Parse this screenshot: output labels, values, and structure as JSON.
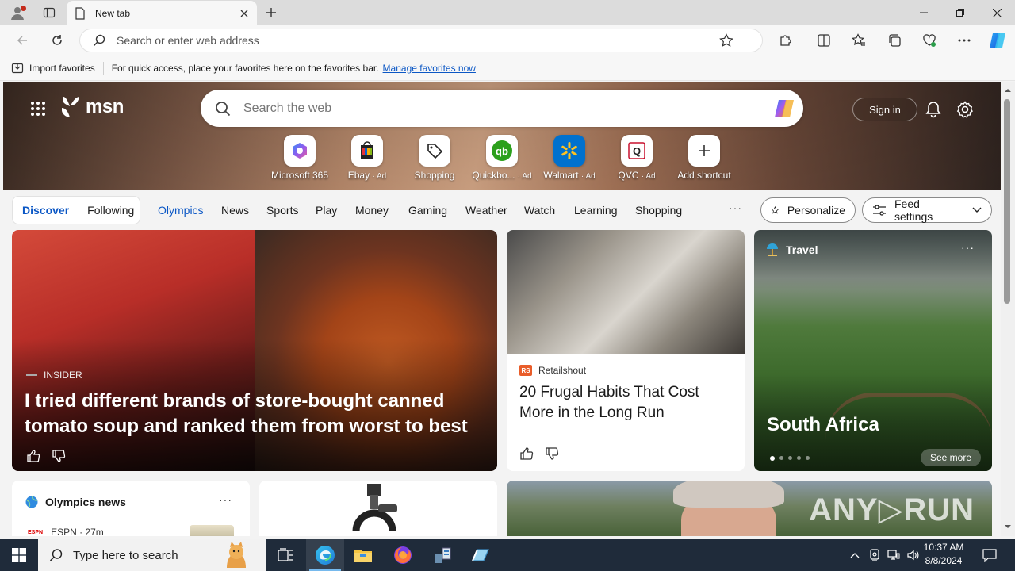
{
  "browser": {
    "tab_title": "New tab",
    "address_placeholder": "Search or enter web address",
    "favbar": {
      "import_label": "Import favorites",
      "message": "For quick access, place your favorites here on the favorites bar.",
      "manage_link": "Manage favorites now"
    }
  },
  "msn": {
    "logo_text": "msn",
    "search_placeholder": "Search the web",
    "signin_label": "Sign in",
    "shortcuts": [
      {
        "label": "Microsoft 365",
        "ad": ""
      },
      {
        "label": "Ebay",
        "ad": "· Ad"
      },
      {
        "label": "Shopping",
        "ad": ""
      },
      {
        "label": "Quickbo...",
        "ad": "· Ad"
      },
      {
        "label": "Walmart",
        "ad": "· Ad"
      },
      {
        "label": "QVC",
        "ad": "· Ad"
      },
      {
        "label": "Add shortcut",
        "ad": ""
      }
    ],
    "feed_tabs": {
      "discover": "Discover",
      "following": "Following"
    },
    "categories": [
      "Olympics",
      "News",
      "Sports",
      "Play",
      "Money",
      "Gaming",
      "Weather",
      "Watch",
      "Learning",
      "Shopping"
    ],
    "more_label": "···",
    "personalize_label": "Personalize",
    "feed_settings_label": "Feed settings"
  },
  "cards": {
    "big": {
      "source": "INSIDER",
      "title": "I tried different brands of store-bought canned tomato soup and ranked them from worst to best"
    },
    "mid": {
      "source_badge": "RS",
      "source": "Retailshout",
      "title": "20 Frugal Habits That Cost More in the Long Run"
    },
    "travel": {
      "category": "Travel",
      "more": "···",
      "place": "South Africa",
      "see_more": "See more"
    },
    "olympics": {
      "title": "Olympics news",
      "more": "···",
      "source_logo": "ESPN",
      "source": "ESPN · 27m"
    },
    "photo": {
      "watermark": "ANY▷RUN"
    }
  },
  "taskbar": {
    "search_placeholder": "Type here to search",
    "time": "10:37 AM",
    "date": "8/8/2024"
  },
  "colors": {
    "accent": "#0b57c5",
    "taskbar": "#1f2b3a"
  }
}
